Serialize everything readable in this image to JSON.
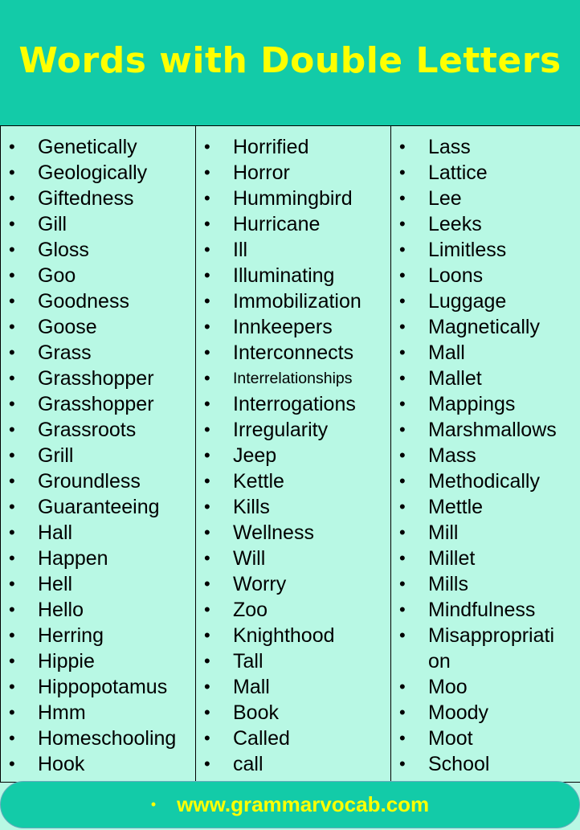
{
  "title": "Words with Double Letters",
  "columns": [
    [
      "Genetically",
      "Geologically",
      "Giftedness",
      "Gill",
      "Gloss",
      "Goo",
      "Goodness",
      "Goose",
      "Grass",
      "Grasshopper",
      "Grasshopper",
      "Grassroots",
      "Grill",
      "Groundless",
      "Guaranteeing",
      "Hall",
      "Happen",
      "Hell",
      "Hello",
      "Herring",
      "Hippie",
      "Hippopotamus",
      "Hmm",
      "Homeschooling",
      "Hook"
    ],
    [
      "Horrified",
      "Horror",
      "Hummingbird",
      "Hurricane",
      "Ill",
      "Illuminating",
      "Immobilization",
      "Innkeepers",
      "Interconnects",
      "Interrelationships",
      "Interrogations",
      "Irregularity",
      "Jeep",
      "Kettle",
      "Kills",
      "Wellness",
      "Will",
      "Worry",
      "Zoo",
      "Knighthood",
      "Tall",
      "Mall",
      "Book",
      "Called",
      "call"
    ],
    [
      "Lass",
      "Lattice",
      "Lee",
      "Leeks",
      "Limitless",
      "Loons",
      "Luggage",
      "Magnetically",
      "Mall",
      "Mallet",
      "Mappings",
      "Marshmallows",
      "Mass",
      "Methodically",
      "Mettle",
      "Mill",
      "Millet",
      "Mills",
      "Mindfulness",
      "Misappropriati on",
      "Moo",
      "Moody",
      "Moot",
      "School"
    ]
  ],
  "bullet": "•",
  "footer": {
    "bullet": "•",
    "text": "www.grammarvocab.com"
  },
  "colors": {
    "header_bg": "#13cba8",
    "title": "#ffff00",
    "table_bg": "#b8f8e4"
  }
}
